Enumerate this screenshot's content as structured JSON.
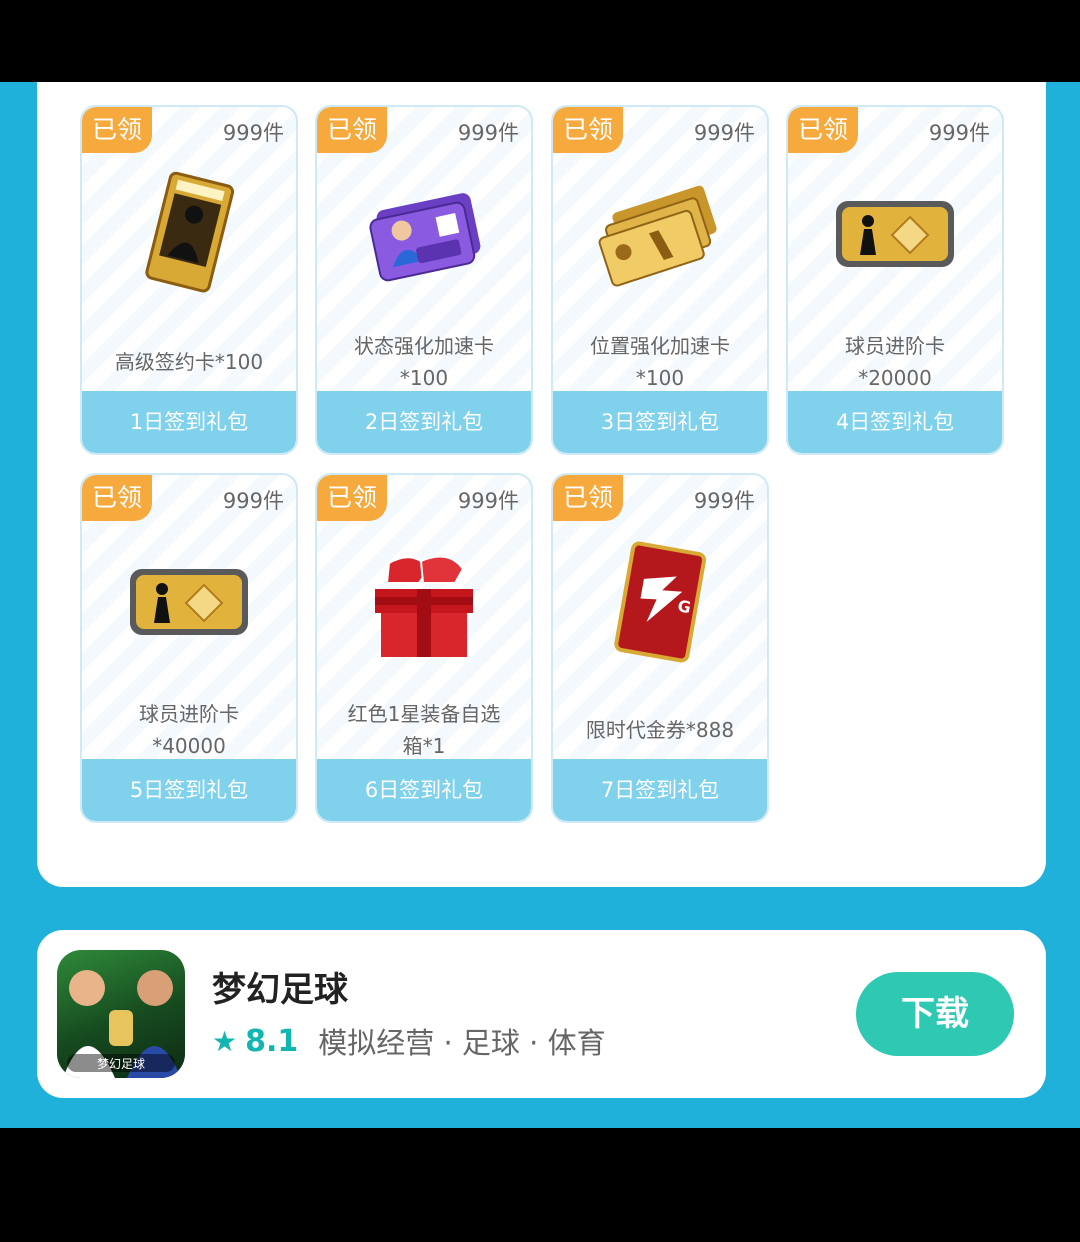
{
  "gifts": [
    {
      "claimed_label": "已领",
      "count": "999件",
      "name": "高级签约卡*100",
      "footer": "1日签到礼包",
      "icon": "contract-card-icon"
    },
    {
      "claimed_label": "已领",
      "count": "999件",
      "name": "状态强化加速卡\n*100",
      "footer": "2日签到礼包",
      "icon": "speedup-card-icon"
    },
    {
      "claimed_label": "已领",
      "count": "999件",
      "name": "位置强化加速卡\n*100",
      "footer": "3日签到礼包",
      "icon": "gold-tickets-icon"
    },
    {
      "claimed_label": "已领",
      "count": "999件",
      "name": "球员进阶卡\n*20000",
      "footer": "4日签到礼包",
      "icon": "player-advance-card-icon"
    },
    {
      "claimed_label": "已领",
      "count": "999件",
      "name": "球员进阶卡\n*40000",
      "footer": "5日签到礼包",
      "icon": "player-advance-card-icon"
    },
    {
      "claimed_label": "已领",
      "count": "999件",
      "name": "红色1星装备自选\n箱*1",
      "footer": "6日签到礼包",
      "icon": "gift-box-shoes-icon"
    },
    {
      "claimed_label": "已领",
      "count": "999件",
      "name": "限时代金券*888",
      "footer": "7日签到礼包",
      "icon": "voucher-card-icon"
    }
  ],
  "app": {
    "name": "梦幻足球",
    "rating": "8.1",
    "tags": "模拟经营 · 足球 · 体育",
    "download_label": "下载",
    "icon_text": "梦幻足球",
    "icon": "app-icon"
  },
  "colors": {
    "accent_blue": "#1fb1da",
    "badge_orange": "#f6a93d",
    "footer_blue": "#7fd1ec",
    "download_green": "#2ec8b3"
  }
}
